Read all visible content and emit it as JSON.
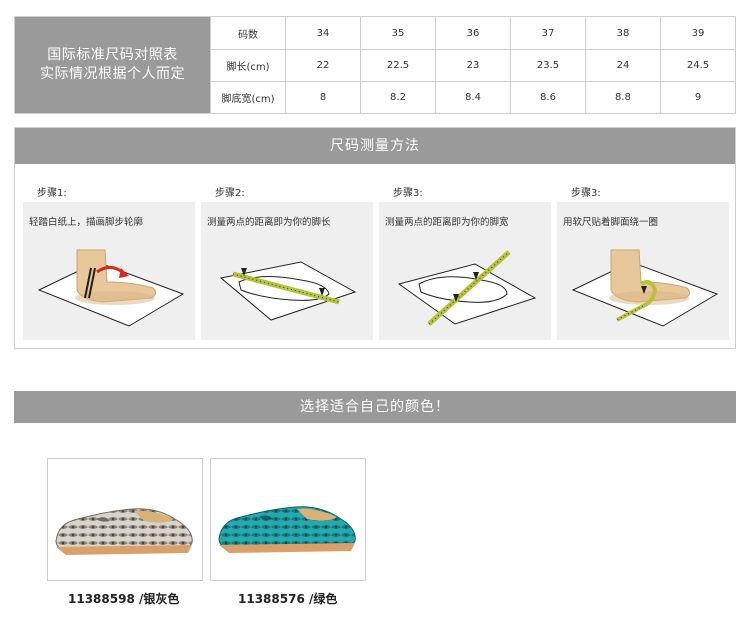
{
  "size_chart": {
    "title_line1": "国际标准尺码对照表",
    "title_line2": "实际情况根据个人而定",
    "rows": [
      {
        "label": "码数",
        "values": [
          "34",
          "35",
          "36",
          "37",
          "38",
          "39"
        ]
      },
      {
        "label": "脚长(cm)",
        "values": [
          "22",
          "22.5",
          "23",
          "23.5",
          "24",
          "24.5"
        ]
      },
      {
        "label": "脚底宽(cm)",
        "values": [
          "8",
          "8.2",
          "8.4",
          "8.6",
          "8.8",
          "9"
        ]
      }
    ]
  },
  "measure": {
    "title": "尺码测量方法",
    "steps": [
      {
        "title": "步骤1:",
        "desc": "轻踏白纸上，描画脚步轮廓"
      },
      {
        "title": "步骤2:",
        "desc": "测量两点的距离即为你的脚长"
      },
      {
        "title": "步骤3:",
        "desc": "测量两点的距离即为你的脚宽"
      },
      {
        "title": "步骤3:",
        "desc": "用软尺贴着脚面绕一圈"
      }
    ]
  },
  "colors": {
    "title": "选择适合自己的颜色！",
    "products": [
      {
        "label": "11388598 /银灰色",
        "color": "#bdb8ae"
      },
      {
        "label": "11388576 /绿色",
        "color": "#1f9ea5"
      }
    ]
  }
}
